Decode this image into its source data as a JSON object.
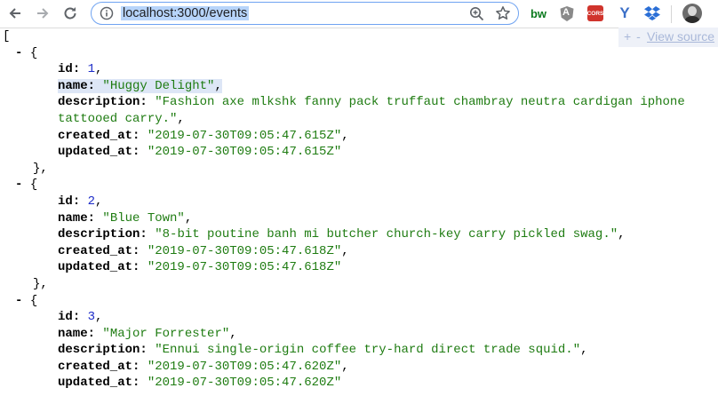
{
  "browser": {
    "url": "localhost:3000/events",
    "view_source_controls": "+ -",
    "view_source_label": "View source",
    "extensions": [
      {
        "name": "bw-extension-icon",
        "label": "bw"
      },
      {
        "name": "angular-extension-icon",
        "label": "A"
      },
      {
        "name": "cors-extension-icon",
        "label": "cors"
      },
      {
        "name": "yoast-extension-icon",
        "label": "Y"
      },
      {
        "name": "dropbox-extension-icon",
        "label": ""
      }
    ]
  },
  "json": {
    "open_bracket": "[",
    "toggle": "-",
    "open_brace": "{",
    "close_brace": "},",
    "keys": {
      "id": "id",
      "name": "name",
      "description": "description",
      "created_at": "created_at",
      "updated_at": "updated_at"
    },
    "events": [
      {
        "id": "1",
        "name": "\"Huggy Delight\"",
        "description_line1": "\"Fashion axe mlkshk fanny pack truffaut chambray neutra cardigan iphone",
        "description_line2": "tattooed carry.\"",
        "created_at": "\"2019-07-30T09:05:47.615Z\"",
        "updated_at": "\"2019-07-30T09:05:47.615Z\""
      },
      {
        "id": "2",
        "name": "\"Blue Town\"",
        "description_line1": "\"8-bit poutine banh mi butcher church-key carry pickled swag.\"",
        "created_at": "\"2019-07-30T09:05:47.618Z\"",
        "updated_at": "\"2019-07-30T09:05:47.618Z\""
      },
      {
        "id": "3",
        "name": "\"Major Forrester\"",
        "description_line1": "\"Ennui single-origin coffee try-hard direct trade squid.\"",
        "created_at": "\"2019-07-30T09:05:47.620Z\"",
        "updated_at": "\"2019-07-30T09:05:47.620Z\""
      }
    ]
  },
  "colors": {
    "string": "#1f7c12",
    "number": "#1c2bc8",
    "omnibox_border": "#6fa3f1",
    "url_selection": "#b7d4fa"
  }
}
